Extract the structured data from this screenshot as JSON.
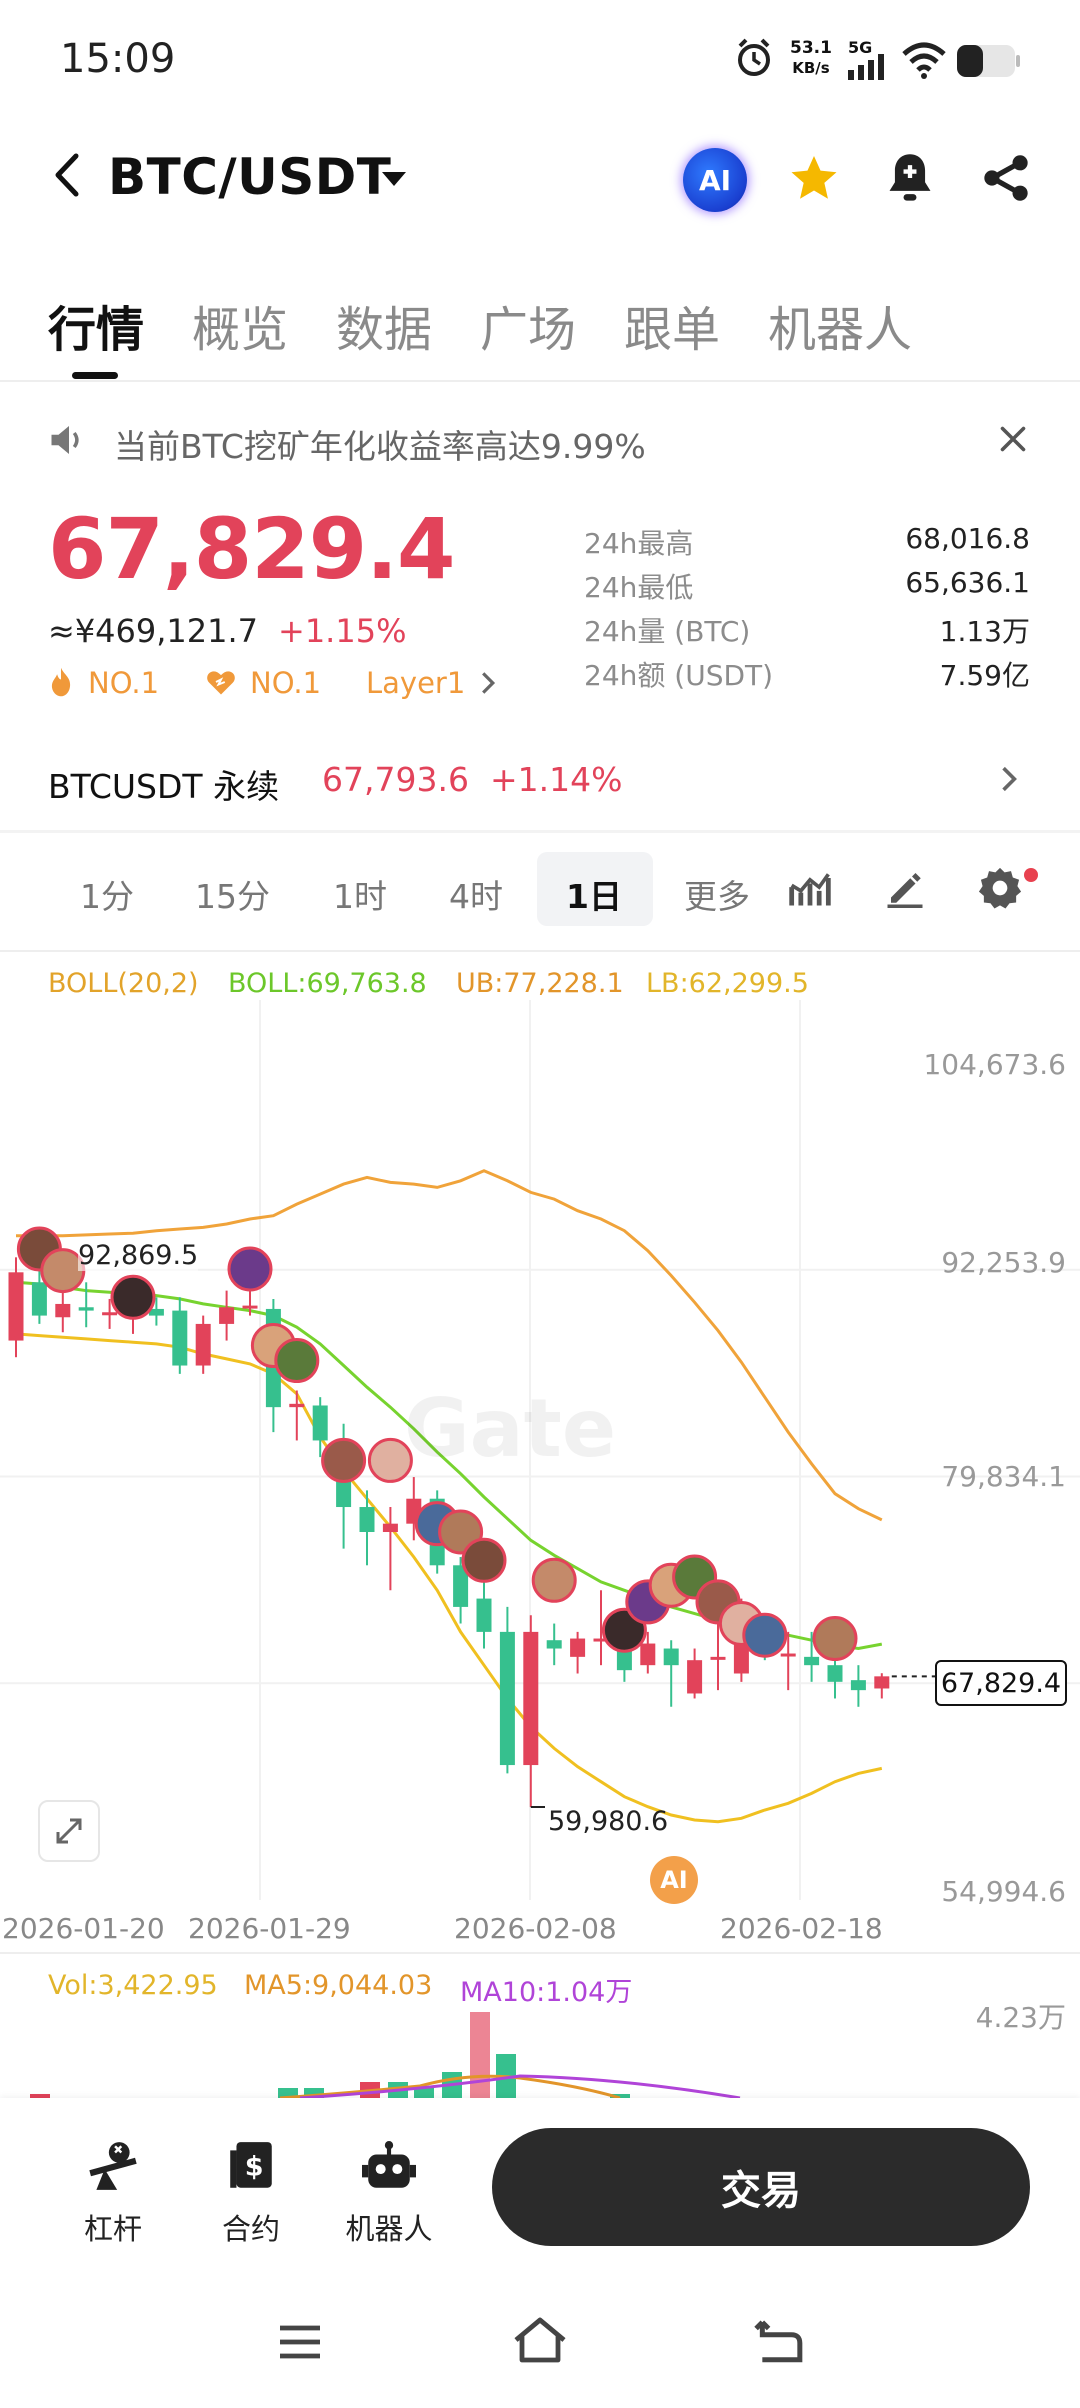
{
  "status_bar": {
    "time": "15:09",
    "net_speed": "53.1",
    "net_unit": "KB/s",
    "network": "5G"
  },
  "header": {
    "pair": "BTC/USDT",
    "ai_label": "AI"
  },
  "tabs": [
    {
      "label": "行情",
      "active": true
    },
    {
      "label": "概览",
      "active": false
    },
    {
      "label": "数据",
      "active": false
    },
    {
      "label": "广场",
      "active": false
    },
    {
      "label": "跟单",
      "active": false
    },
    {
      "label": "机器人",
      "active": false
    }
  ],
  "notice": {
    "text": "当前BTC挖矿年化收益率高达9.99%"
  },
  "ticker": {
    "price": "67,829.4",
    "cny": "≈¥469,121.7",
    "change": "+1.15%",
    "tags": [
      "NO.1",
      "NO.1",
      "Layer1"
    ],
    "stats": [
      {
        "label": "24h最高",
        "value": "68,016.8"
      },
      {
        "label": "24h最低",
        "value": "65,636.1"
      },
      {
        "label": "24h量 (BTC)",
        "value": "1.13万"
      },
      {
        "label": "24h额 (USDT)",
        "value": "7.59亿"
      }
    ]
  },
  "perpetual": {
    "name": "BTCUSDT 永续",
    "price": "67,793.6",
    "change": "+1.14%"
  },
  "intervals": [
    "1分",
    "15分",
    "1时",
    "4时",
    "1日",
    "更多"
  ],
  "active_interval": "1日",
  "indicators": {
    "boll": "BOLL(20,2)",
    "mid": "BOLL:69,763.8",
    "ub": "UB:77,228.1",
    "lb": "LB:62,299.5"
  },
  "chart_data": {
    "type": "candlestick",
    "y_axis_labels": [
      "104,673.6",
      "92,253.9",
      "79,834.1",
      "54,994.6"
    ],
    "x_axis_labels": [
      "2026-01-20",
      "2026-01-29",
      "2026-02-08",
      "2026-02-18"
    ],
    "current_price": "67,829.4",
    "high_marker": "92,869.5",
    "low_marker": "59,980.6",
    "ylim": [
      54994.6,
      104673.6
    ],
    "candles": [
      {
        "o": 88000,
        "h": 93000,
        "l": 87000,
        "c": 92100
      },
      {
        "o": 91500,
        "h": 92869.5,
        "l": 89000,
        "c": 89500
      },
      {
        "o": 89400,
        "h": 92500,
        "l": 88500,
        "c": 90200
      },
      {
        "o": 90000,
        "h": 91500,
        "l": 88800,
        "c": 89800
      },
      {
        "o": 89700,
        "h": 90500,
        "l": 88700,
        "c": 89700
      },
      {
        "o": 89600,
        "h": 91200,
        "l": 88400,
        "c": 90300
      },
      {
        "o": 89900,
        "h": 90600,
        "l": 88900,
        "c": 89500
      },
      {
        "o": 89800,
        "h": 90600,
        "l": 86000,
        "c": 86500
      },
      {
        "o": 86500,
        "h": 89500,
        "l": 86000,
        "c": 89000
      },
      {
        "o": 89000,
        "h": 91000,
        "l": 88000,
        "c": 90000
      },
      {
        "o": 90000,
        "h": 92000,
        "l": 89500,
        "c": 90100
      },
      {
        "o": 89900,
        "h": 90500,
        "l": 82500,
        "c": 84000
      },
      {
        "o": 84000,
        "h": 85000,
        "l": 82000,
        "c": 84200
      },
      {
        "o": 84100,
        "h": 84600,
        "l": 81000,
        "c": 82000
      },
      {
        "o": 82000,
        "h": 83000,
        "l": 75500,
        "c": 78000
      },
      {
        "o": 78000,
        "h": 79000,
        "l": 74500,
        "c": 76500
      },
      {
        "o": 76500,
        "h": 78000,
        "l": 73000,
        "c": 77000
      },
      {
        "o": 77000,
        "h": 79800,
        "l": 76000,
        "c": 78500
      },
      {
        "o": 78500,
        "h": 79000,
        "l": 74000,
        "c": 74500
      },
      {
        "o": 74500,
        "h": 75000,
        "l": 71000,
        "c": 72000
      },
      {
        "o": 72500,
        "h": 73500,
        "l": 69500,
        "c": 70500
      },
      {
        "o": 70500,
        "h": 72000,
        "l": 62000,
        "c": 62500
      },
      {
        "o": 62500,
        "h": 71500,
        "l": 59980.6,
        "c": 70500
      },
      {
        "o": 70000,
        "h": 71000,
        "l": 68500,
        "c": 69500
      },
      {
        "o": 69000,
        "h": 70500,
        "l": 68000,
        "c": 70100
      },
      {
        "o": 70000,
        "h": 73000,
        "l": 68500,
        "c": 70100
      },
      {
        "o": 69800,
        "h": 71000,
        "l": 67500,
        "c": 68200
      },
      {
        "o": 68500,
        "h": 70500,
        "l": 68000,
        "c": 69800
      },
      {
        "o": 69500,
        "h": 70000,
        "l": 66000,
        "c": 68500
      },
      {
        "o": 66800,
        "h": 69500,
        "l": 66500,
        "c": 68800
      },
      {
        "o": 69000,
        "h": 72000,
        "l": 67000,
        "c": 69000
      },
      {
        "o": 68000,
        "h": 72500,
        "l": 67500,
        "c": 71500
      },
      {
        "o": 70000,
        "h": 71000,
        "l": 68800,
        "c": 69500
      },
      {
        "o": 69200,
        "h": 70500,
        "l": 67000,
        "c": 69200
      },
      {
        "o": 69000,
        "h": 70500,
        "l": 67500,
        "c": 68500
      },
      {
        "o": 68500,
        "h": 69000,
        "l": 66500,
        "c": 67500
      },
      {
        "o": 67600,
        "h": 68500,
        "l": 66000,
        "c": 67000
      },
      {
        "o": 67100,
        "h": 68016.8,
        "l": 66500,
        "c": 67829.4
      }
    ],
    "ub": [
      94300,
      94300,
      94300,
      94350,
      94400,
      94450,
      94600,
      94700,
      94800,
      95000,
      95300,
      95500,
      96200,
      96800,
      97400,
      97800,
      97500,
      97400,
      97200,
      97600,
      98200,
      97600,
      96900,
      96500,
      95800,
      95300,
      94600,
      93400,
      91900,
      90300,
      88600,
      86700,
      84600,
      82500,
      80600,
      78800,
      77900,
      77228.1
    ],
    "mid": [
      91500,
      91400,
      91200,
      91000,
      90900,
      90800,
      90700,
      90500,
      90200,
      90000,
      89800,
      89500,
      88800,
      87800,
      86500,
      85200,
      84000,
      82700,
      81300,
      80000,
      78600,
      77300,
      76000,
      75100,
      74300,
      73500,
      73000,
      72500,
      72000,
      71600,
      71200,
      70900,
      70600,
      70300,
      70000,
      69700,
      69500,
      69763.8
    ],
    "lb": [
      88400,
      88300,
      88200,
      88100,
      88000,
      87900,
      87800,
      87600,
      87200,
      86900,
      86600,
      86000,
      84800,
      82200,
      80200,
      78500,
      76800,
      75000,
      73000,
      70500,
      68500,
      66500,
      64800,
      63500,
      62400,
      61500,
      60600,
      60000,
      59500,
      59200,
      59100,
      59300,
      59800,
      60200,
      60800,
      61500,
      62000,
      62299.5
    ]
  },
  "volume": {
    "vol": "Vol:3,422.95",
    "ma5": "MA5:9,044.03",
    "ma10": "MA10:1.04万",
    "max_label": "4.23万"
  },
  "colors": {
    "up": "#e2435a",
    "down": "#36c08e",
    "ub": "#f0a33a",
    "mid": "#77d32f",
    "lb": "#f0c020",
    "ma10": "#b044d8"
  },
  "bottom_nav": [
    {
      "label": "杠杆",
      "icon": "leverage-icon"
    },
    {
      "label": "合约",
      "icon": "futures-icon"
    },
    {
      "label": "机器人",
      "icon": "robot-icon"
    }
  ],
  "trade_button": "交易"
}
